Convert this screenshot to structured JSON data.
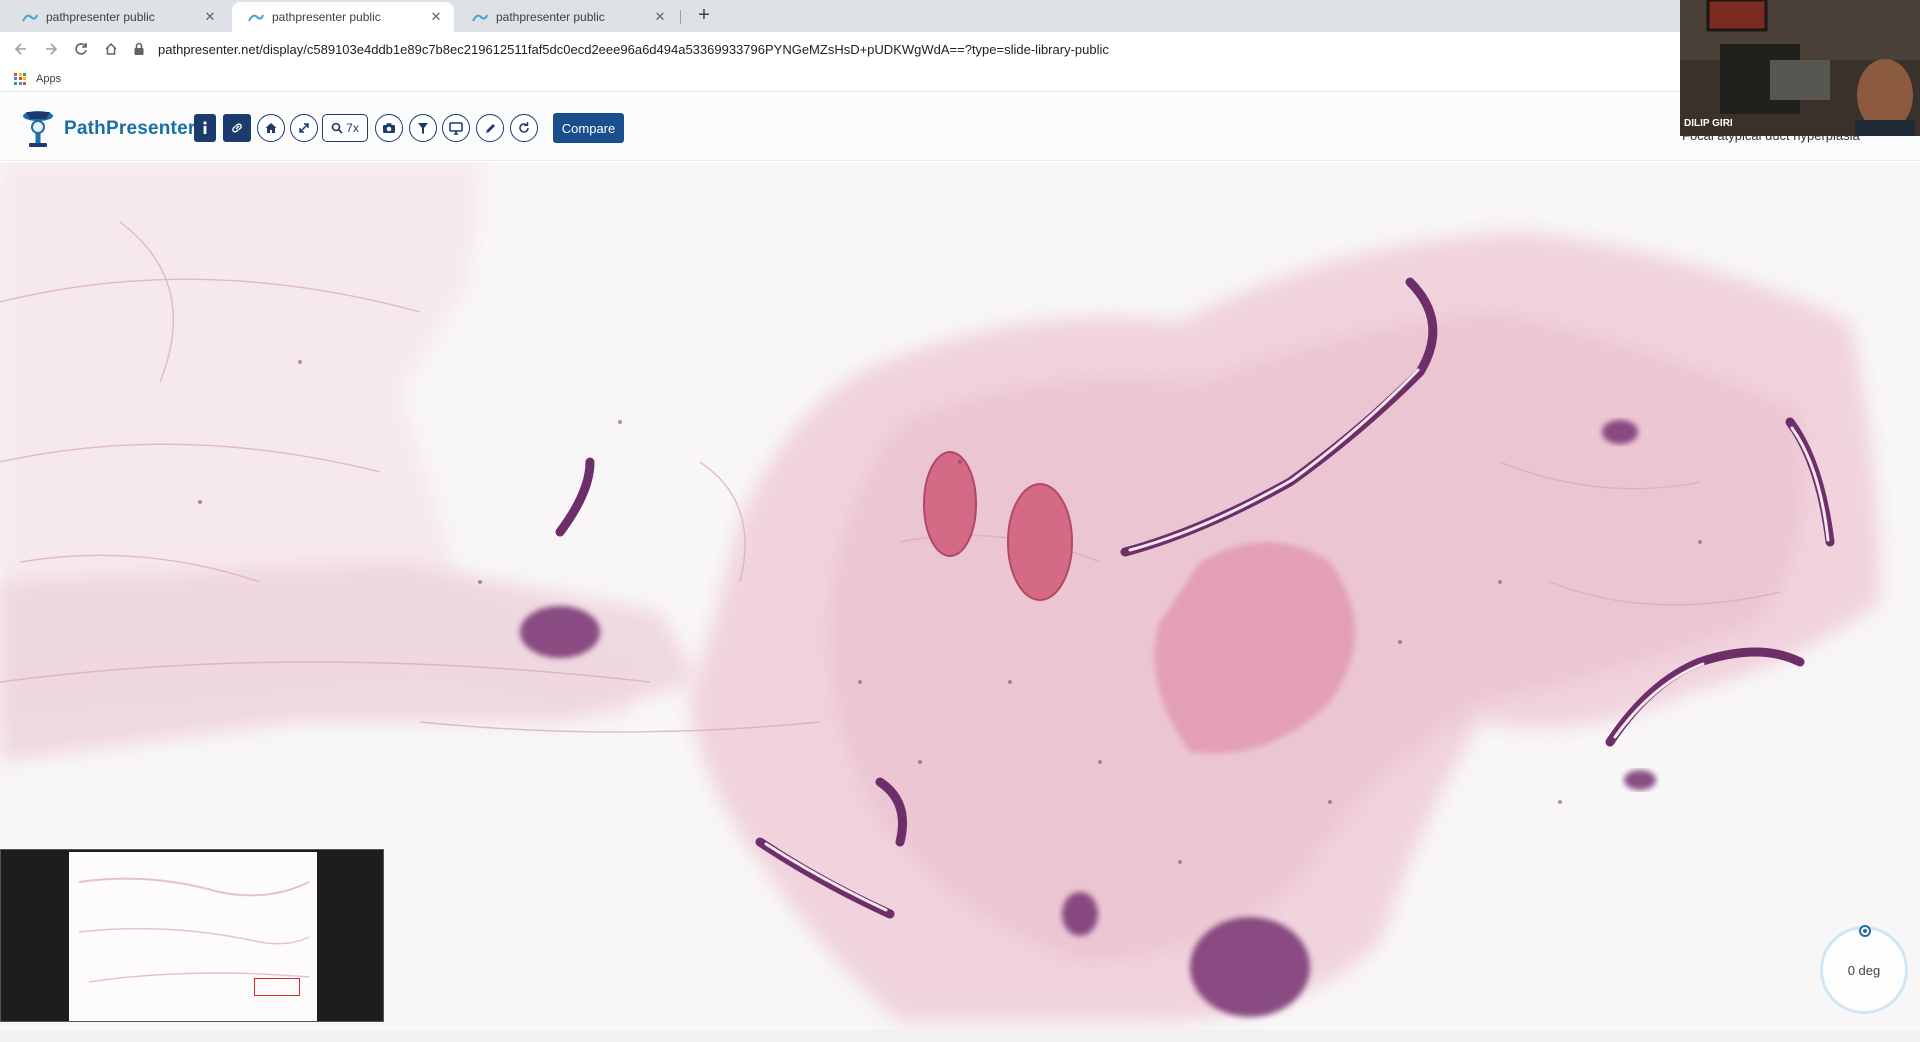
{
  "browser": {
    "tabs": [
      {
        "title": "pathpresenter public",
        "active": false
      },
      {
        "title": "pathpresenter public",
        "active": true
      },
      {
        "title": "pathpresenter public",
        "active": false
      }
    ],
    "new_tab_label": "+",
    "close_label": "✕",
    "url": "pathpresenter.net/display/c589103e4ddb1e89c7b8ec219612511faf5dc0ecd2eee96a6d494a53369933796PYNGeMZsHsD+pUDKWgWdA==?type=slide-library-public",
    "bookmarks": [
      {
        "label": "Apps"
      }
    ]
  },
  "app": {
    "brand": "PathPresenter",
    "zoom_label": "7x",
    "compare_label": "Compare",
    "slide_title": "Focal atypical duct hyperplasia",
    "toolbar_icons": [
      "info-icon",
      "link-icon",
      "home-icon",
      "fullscreen-icon",
      "zoom-icon",
      "camera-icon",
      "filter-icon",
      "monitor-icon",
      "pen-icon",
      "refresh-icon"
    ]
  },
  "webcam": {
    "presenter_name": "DILIP GIRI"
  },
  "viewer": {
    "rotation_label": "0 deg",
    "rotation_degrees": 0,
    "zoom_level": 7
  },
  "colors": {
    "brand_blue": "#1b6fa8",
    "toolbar_navy": "#1a3b6b",
    "compare_blue": "#1a4f8e",
    "tissue_pink": "#e6a3b9",
    "epithelium_purple": "#6e2e6a",
    "viewport_red": "#d42a2a"
  }
}
